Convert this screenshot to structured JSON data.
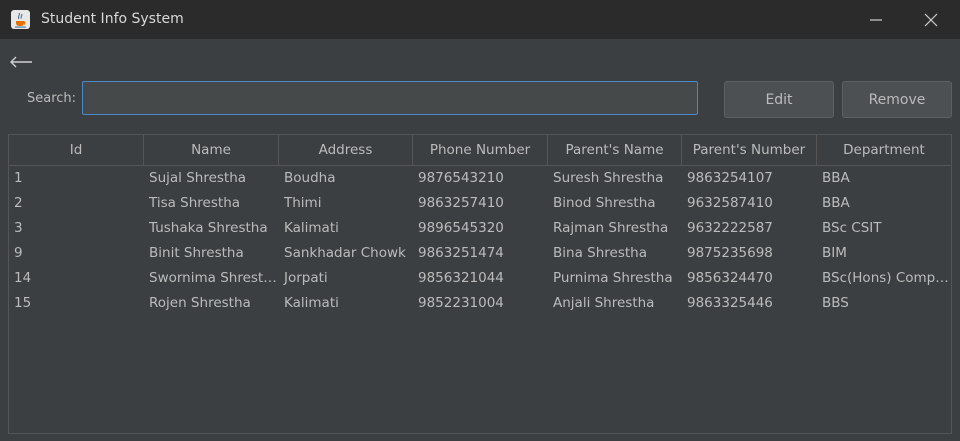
{
  "window": {
    "title": "Student Info System",
    "icon": "java-cup-icon",
    "minimize_icon": "minimize-icon",
    "close_icon": "close-icon"
  },
  "toolbar": {
    "back_icon": "back-arrow-icon",
    "search_label": "Search:",
    "search_value": "",
    "edit_label": "Edit",
    "remove_label": "Remove"
  },
  "table": {
    "columns": [
      "Id",
      "Name",
      "Address",
      "Phone Number",
      "Parent's Name",
      "Parent's Number",
      "Department"
    ],
    "rows": [
      [
        "1",
        "Sujal Shrestha",
        "Boudha",
        "9876543210",
        "Suresh Shrestha",
        "9863254107",
        "BBA"
      ],
      [
        "2",
        "Tisa Shrestha",
        "Thimi",
        "9863257410",
        "Binod Shrestha",
        "9632587410",
        "BBA"
      ],
      [
        "3",
        "Tushaka Shrestha",
        "Kalimati",
        "9896545320",
        "Rajman Shrestha",
        "9632222587",
        "BSc CSIT"
      ],
      [
        "9",
        "Binit Shrestha",
        "Sankhadar Chowk",
        "9863251474",
        "Bina Shrestha",
        "9875235698",
        "BIM"
      ],
      [
        "14",
        "Swornima Shrestha",
        "Jorpati",
        "9856321044",
        "Purnima Shrestha",
        "9856324470",
        "BSc(Hons) Compu..."
      ],
      [
        "15",
        "Rojen Shrestha",
        "Kalimati",
        "9852231004",
        "Anjali Shrestha",
        "9863325446",
        "BBS"
      ]
    ]
  },
  "colors": {
    "window_bg": "#3c3f41",
    "titlebar_bg": "#2b2b2b",
    "text": "#bbbbbb",
    "focus_border": "#4a88c7"
  }
}
